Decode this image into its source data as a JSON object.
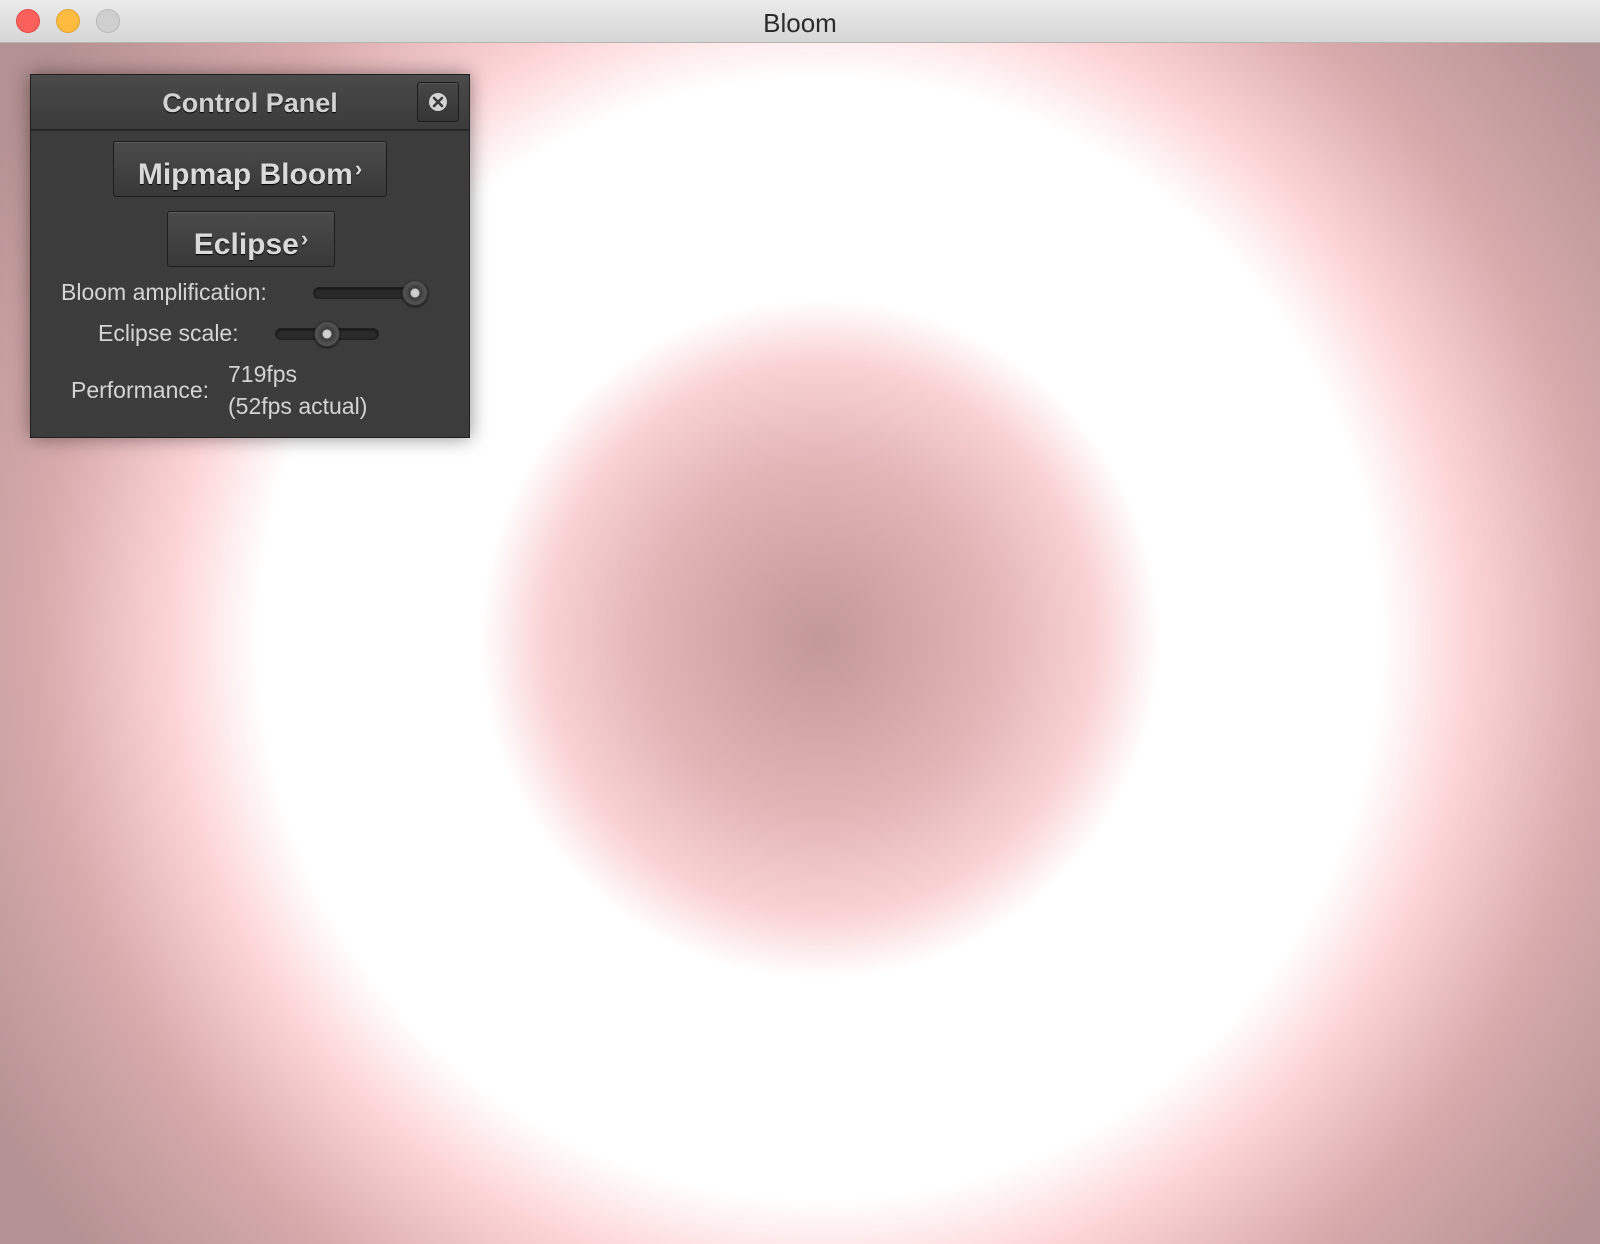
{
  "window": {
    "title": "Bloom"
  },
  "panel": {
    "title": "Control Panel",
    "buttons": {
      "mipmap_bloom": "Mipmap Bloom",
      "eclipse": "Eclipse",
      "chevron": "›"
    },
    "sliders": {
      "bloom_amplification": {
        "label": "Bloom amplification:",
        "value_fraction": 0.95
      },
      "eclipse_scale": {
        "label": "Eclipse scale:",
        "value_fraction": 0.5
      }
    },
    "performance": {
      "label": "Performance:",
      "line1": "719fps",
      "line2": "(52fps actual)"
    }
  },
  "icons": {
    "window_close": "close-dot",
    "window_minimize": "minimize-dot",
    "window_zoom": "zoom-dot",
    "panel_close": "close-circle-icon"
  },
  "colors": {
    "traffic_close": "#fc605c",
    "traffic_minimize": "#fdbc40",
    "traffic_zoom": "#cfcfcf",
    "panel_bg": "#3c3c3c",
    "bloom_center": "#c39898",
    "bloom_ring": "#ffffff"
  }
}
